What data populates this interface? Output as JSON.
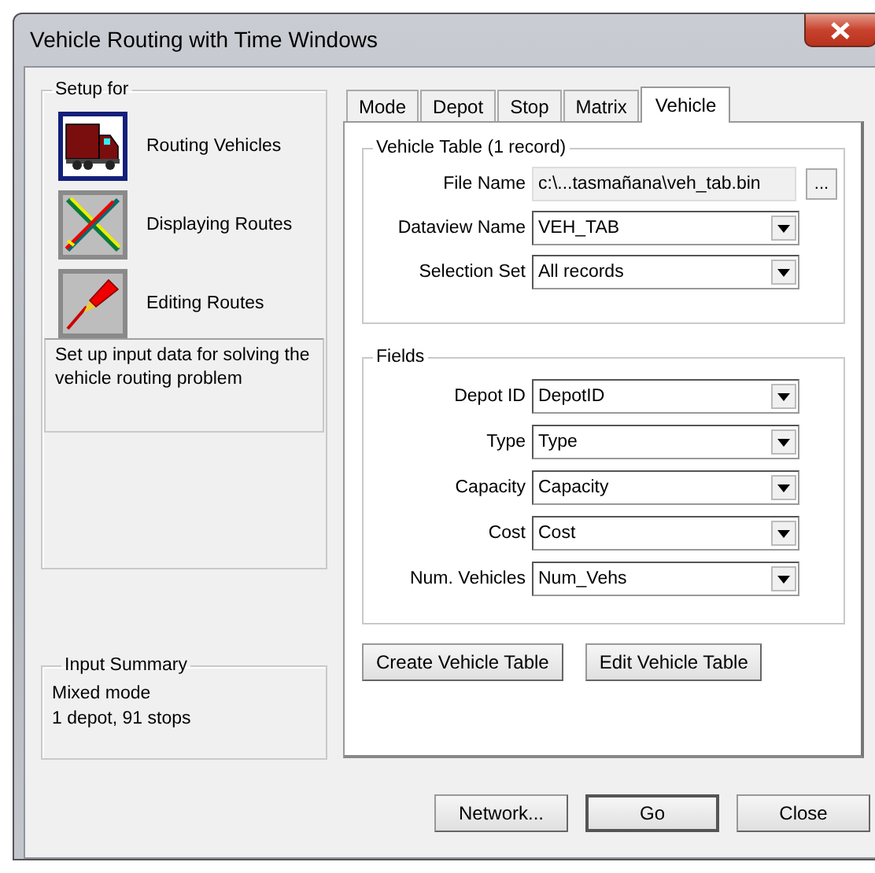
{
  "window": {
    "title": "Vehicle Routing with Time Windows"
  },
  "setup": {
    "title": "Setup for",
    "items": [
      {
        "label": "Routing Vehicles",
        "kind": "truck",
        "selected": true
      },
      {
        "label": "Displaying Routes",
        "kind": "routes",
        "selected": false
      },
      {
        "label": "Editing Routes",
        "kind": "pencil",
        "selected": false
      }
    ],
    "description": "Set up input data for solving the vehicle routing problem"
  },
  "input_summary": {
    "title": "Input Summary",
    "lines": [
      "Mixed mode",
      "1 depot, 91 stops"
    ]
  },
  "tabs": [
    {
      "label": "Mode",
      "selected": false
    },
    {
      "label": "Depot",
      "selected": false
    },
    {
      "label": "Stop",
      "selected": false
    },
    {
      "label": "Matrix",
      "selected": false
    },
    {
      "label": "Vehicle",
      "selected": true
    }
  ],
  "vehicle_table": {
    "title": "Vehicle Table (1 record)",
    "rows": [
      {
        "label": "File Name",
        "value": "c:\\...tasmañana\\veh_tab.bin",
        "kind": "file",
        "button": "..."
      },
      {
        "label": "Dataview Name",
        "value": "VEH_TAB",
        "kind": "dropdown"
      },
      {
        "label": "Selection Set",
        "value": "All records",
        "kind": "dropdown"
      }
    ]
  },
  "fields": {
    "title": "Fields",
    "rows": [
      {
        "label": "Depot ID",
        "value": "DepotID",
        "kind": "dropdown"
      },
      {
        "label": "Type",
        "value": "Type",
        "kind": "dropdown"
      },
      {
        "label": "Capacity",
        "value": "Capacity",
        "kind": "dropdown"
      },
      {
        "label": "Cost",
        "value": "Cost",
        "kind": "dropdown"
      },
      {
        "label": "Num. Vehicles",
        "value": "Num_Vehs",
        "kind": "dropdown"
      }
    ]
  },
  "panel_buttons": [
    "Create Vehicle Table",
    "Edit Vehicle Table"
  ],
  "buttons": [
    {
      "label": "Network...",
      "default": false
    },
    {
      "label": "Go",
      "default": true
    },
    {
      "label": "Close",
      "default": false
    }
  ]
}
